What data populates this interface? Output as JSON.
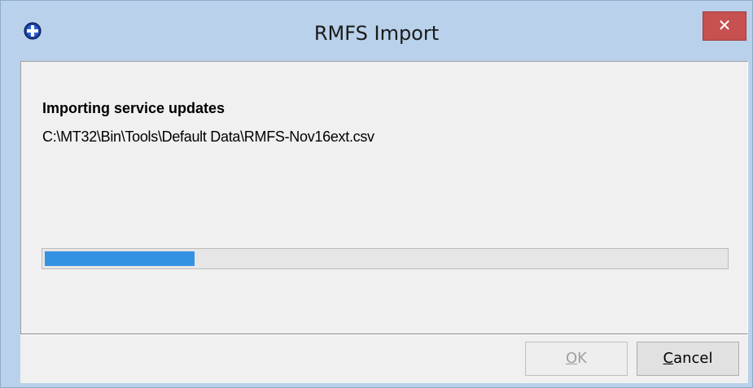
{
  "window": {
    "title": "RMFS Import",
    "close_label": "✕",
    "app_icon": "blue-circle-cross-icon"
  },
  "main": {
    "heading": "Importing service updates",
    "file_path": "C:\\MT32\\Bin\\Tools\\Default Data\\RMFS-Nov16ext.csv",
    "progress_fraction": 0.22
  },
  "footer": {
    "ok": {
      "mnemonic": "O",
      "rest": "K",
      "enabled": false
    },
    "cancel": {
      "mnemonic": "C",
      "rest": "ancel",
      "enabled": true
    }
  },
  "colors": {
    "titlebar": "#b9d1ea",
    "close": "#c75050",
    "progress_fill": "#3592e2",
    "dialog_bg": "#f0f0f0"
  }
}
